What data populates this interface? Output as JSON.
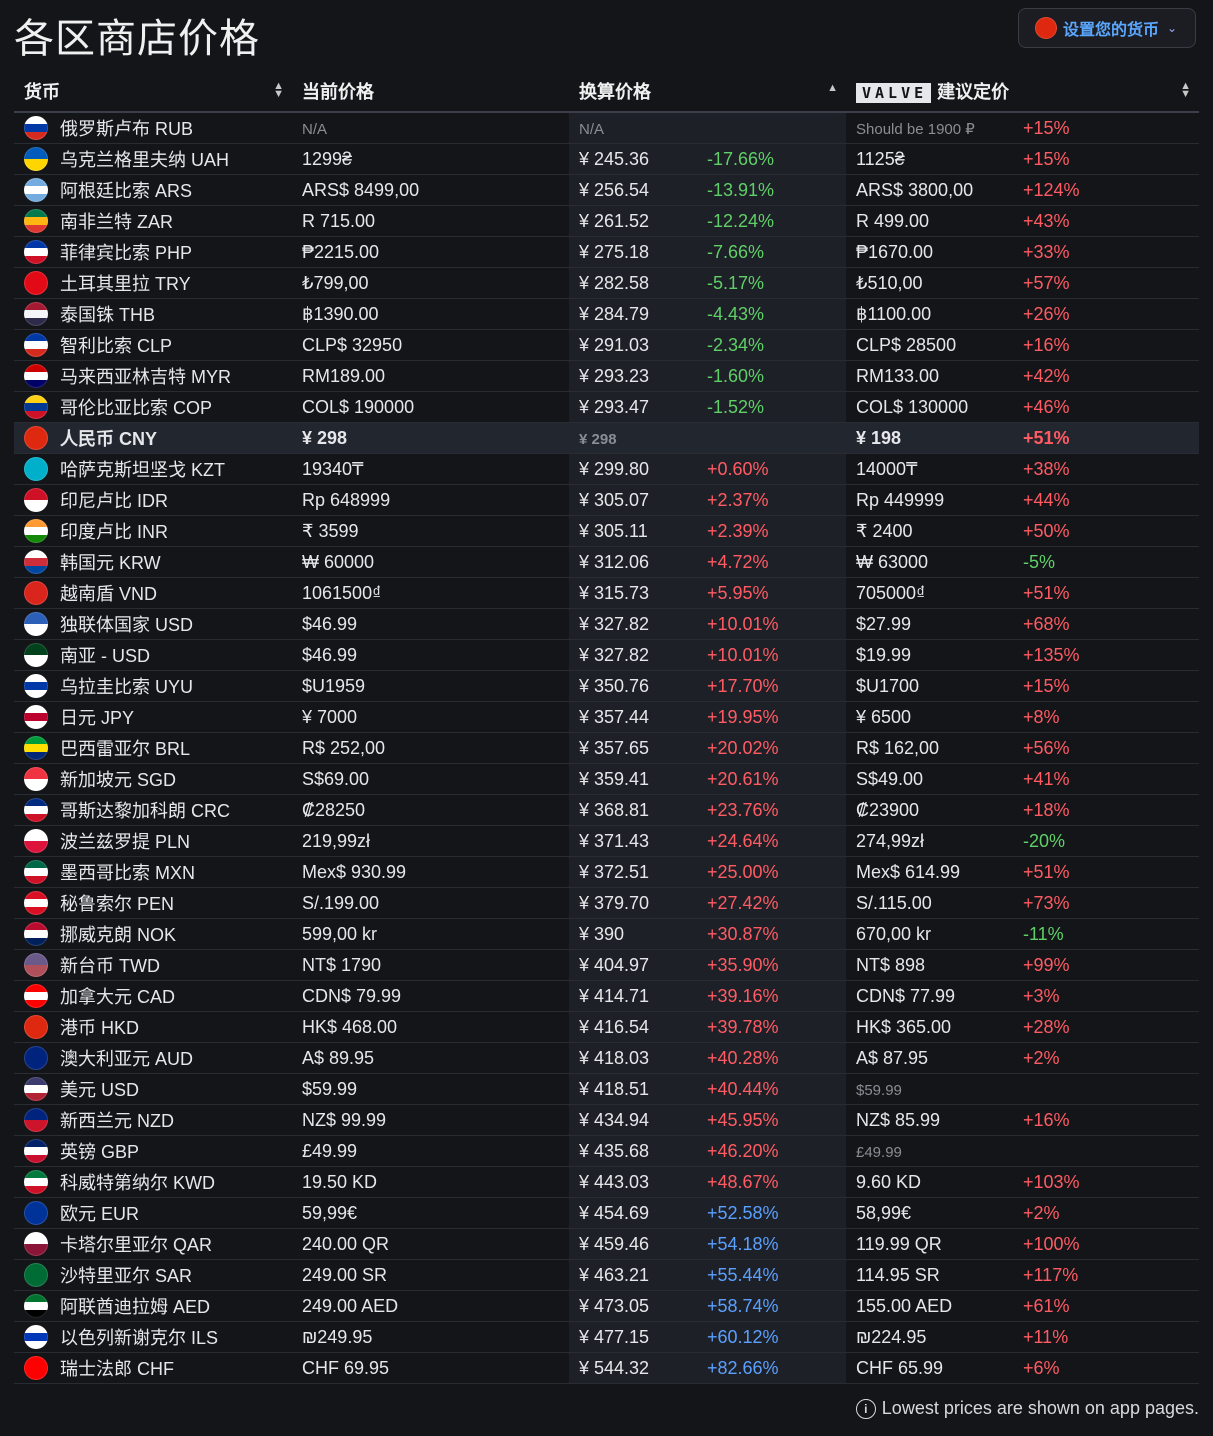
{
  "page": {
    "title": "各区商店价格",
    "currency_button": "设置您的货币",
    "footer": "Lowest prices are shown on app pages."
  },
  "table": {
    "headers": {
      "currency": "货币",
      "current": "当前价格",
      "converted": "换算价格",
      "valve_badge": "VALVE",
      "recommended": "建议定价"
    },
    "rows": [
      {
        "flag": [
          "#ffffff",
          "#0039a6",
          "#d52b1e"
        ],
        "name": "俄罗斯卢布 RUB",
        "current": "N/A",
        "converted": "N/A",
        "diff": "",
        "rec": "Should be 1900 ₽",
        "rec_diff": "+15%",
        "rec_na": true
      },
      {
        "flag": [
          "#005bbb",
          "#ffd500"
        ],
        "name": "乌克兰格里夫纳 UAH",
        "current": "1299₴",
        "converted": "¥ 245.36",
        "diff": "-17.66%",
        "rec": "1125₴",
        "rec_diff": "+15%"
      },
      {
        "flag": [
          "#74acdf",
          "#ffffff",
          "#74acdf"
        ],
        "name": "阿根廷比索 ARS",
        "current": "ARS$ 8499,00",
        "converted": "¥ 256.54",
        "diff": "-13.91%",
        "rec": "ARS$ 3800,00",
        "rec_diff": "+124%"
      },
      {
        "flag": [
          "#007a4d",
          "#ffb612",
          "#de3831"
        ],
        "name": "南非兰特 ZAR",
        "current": "R 715.00",
        "converted": "¥ 261.52",
        "diff": "-12.24%",
        "rec": "R 499.00",
        "rec_diff": "+43%"
      },
      {
        "flag": [
          "#0038a8",
          "#ffffff",
          "#ce1126"
        ],
        "name": "菲律宾比索 PHP",
        "current": "₱2215.00",
        "converted": "¥ 275.18",
        "diff": "-7.66%",
        "rec": "₱1670.00",
        "rec_diff": "+33%"
      },
      {
        "flag": [
          "#e30a17",
          "#e30a17"
        ],
        "name": "土耳其里拉 TRY",
        "current": "₺799,00",
        "converted": "¥ 282.58",
        "diff": "-5.17%",
        "rec": "₺510,00",
        "rec_diff": "+57%"
      },
      {
        "flag": [
          "#a51931",
          "#f4f5f8",
          "#2d2a4a"
        ],
        "name": "泰国铢 THB",
        "current": "฿1390.00",
        "converted": "¥ 284.79",
        "diff": "-4.43%",
        "rec": "฿1100.00",
        "rec_diff": "+26%"
      },
      {
        "flag": [
          "#0039a6",
          "#ffffff",
          "#d52b1e"
        ],
        "name": "智利比索 CLP",
        "current": "CLP$ 32950",
        "converted": "¥ 291.03",
        "diff": "-2.34%",
        "rec": "CLP$ 28500",
        "rec_diff": "+16%"
      },
      {
        "flag": [
          "#cc0001",
          "#ffffff",
          "#010066"
        ],
        "name": "马来西亚林吉特 MYR",
        "current": "RM189.00",
        "converted": "¥ 293.23",
        "diff": "-1.60%",
        "rec": "RM133.00",
        "rec_diff": "+42%"
      },
      {
        "flag": [
          "#fcd116",
          "#003893",
          "#ce1126"
        ],
        "name": "哥伦比亚比索 COP",
        "current": "COL$ 190000",
        "converted": "¥ 293.47",
        "diff": "-1.52%",
        "rec": "COL$ 130000",
        "rec_diff": "+46%"
      },
      {
        "flag": [
          "#de2910",
          "#de2910"
        ],
        "name": "人民币 CNY",
        "current": "¥ 298",
        "converted": "¥ 298",
        "diff": "",
        "rec": "¥ 198",
        "rec_diff": "+51%",
        "highlight": true
      },
      {
        "flag": [
          "#00afca",
          "#00afca"
        ],
        "name": "哈萨克斯坦坚戈 KZT",
        "current": "19340₸",
        "converted": "¥ 299.80",
        "diff": "+0.60%",
        "rec": "14000₸",
        "rec_diff": "+38%"
      },
      {
        "flag": [
          "#ce1126",
          "#ffffff"
        ],
        "name": "印尼卢比 IDR",
        "current": "Rp 648999",
        "converted": "¥ 305.07",
        "diff": "+2.37%",
        "rec": "Rp 449999",
        "rec_diff": "+44%"
      },
      {
        "flag": [
          "#ff9933",
          "#ffffff",
          "#138808"
        ],
        "name": "印度卢比 INR",
        "current": "₹ 3599",
        "converted": "¥ 305.11",
        "diff": "+2.39%",
        "rec": "₹ 2400",
        "rec_diff": "+50%"
      },
      {
        "flag": [
          "#ffffff",
          "#cd2e3a",
          "#0047a0"
        ],
        "name": "韩国元 KRW",
        "current": "₩ 60000",
        "converted": "¥ 312.06",
        "diff": "+4.72%",
        "rec": "₩ 63000",
        "rec_diff": "-5%"
      },
      {
        "flag": [
          "#da251d",
          "#da251d"
        ],
        "name": "越南盾 VND",
        "current": "1061500₫",
        "converted": "¥ 315.73",
        "diff": "+5.95%",
        "rec": "705000₫",
        "rec_diff": "+51%"
      },
      {
        "flag": [
          "#2b5fb8",
          "#ffffff"
        ],
        "name": "独联体国家 USD",
        "current": "$46.99",
        "converted": "¥ 327.82",
        "diff": "+10.01%",
        "rec": "$27.99",
        "rec_diff": "+68%"
      },
      {
        "flag": [
          "#01411c",
          "#ffffff"
        ],
        "name": "南亚 - USD",
        "current": "$46.99",
        "converted": "¥ 327.82",
        "diff": "+10.01%",
        "rec": "$19.99",
        "rec_diff": "+135%"
      },
      {
        "flag": [
          "#ffffff",
          "#0038a8",
          "#ffffff"
        ],
        "name": "乌拉圭比索 UYU",
        "current": "$U1959",
        "converted": "¥ 350.76",
        "diff": "+17.70%",
        "rec": "$U1700",
        "rec_diff": "+15%"
      },
      {
        "flag": [
          "#ffffff",
          "#bc002d",
          "#ffffff"
        ],
        "name": "日元 JPY",
        "current": "¥ 7000",
        "converted": "¥ 357.44",
        "diff": "+19.95%",
        "rec": "¥ 6500",
        "rec_diff": "+8%"
      },
      {
        "flag": [
          "#009c3b",
          "#ffdf00",
          "#002776"
        ],
        "name": "巴西雷亚尔 BRL",
        "current": "R$ 252,00",
        "converted": "¥ 357.65",
        "diff": "+20.02%",
        "rec": "R$ 162,00",
        "rec_diff": "+56%"
      },
      {
        "flag": [
          "#ef3340",
          "#ffffff"
        ],
        "name": "新加坡元 SGD",
        "current": "S$69.00",
        "converted": "¥ 359.41",
        "diff": "+20.61%",
        "rec": "S$49.00",
        "rec_diff": "+41%"
      },
      {
        "flag": [
          "#002b7f",
          "#ffffff",
          "#ce1126"
        ],
        "name": "哥斯达黎加科朗 CRC",
        "current": "₡28250",
        "converted": "¥ 368.81",
        "diff": "+23.76%",
        "rec": "₡23900",
        "rec_diff": "+18%"
      },
      {
        "flag": [
          "#ffffff",
          "#dc143c"
        ],
        "name": "波兰兹罗提 PLN",
        "current": "219,99zł",
        "converted": "¥ 371.43",
        "diff": "+24.64%",
        "rec": "274,99zł",
        "rec_diff": "-20%"
      },
      {
        "flag": [
          "#006847",
          "#ffffff",
          "#ce1126"
        ],
        "name": "墨西哥比索 MXN",
        "current": "Mex$ 930.99",
        "converted": "¥ 372.51",
        "diff": "+25.00%",
        "rec": "Mex$ 614.99",
        "rec_diff": "+51%"
      },
      {
        "flag": [
          "#d91023",
          "#ffffff",
          "#d91023"
        ],
        "name": "秘鲁索尔 PEN",
        "current": "S/.199.00",
        "converted": "¥ 379.70",
        "diff": "+27.42%",
        "rec": "S/.115.00",
        "rec_diff": "+73%"
      },
      {
        "flag": [
          "#ba0c2f",
          "#ffffff",
          "#00205b"
        ],
        "name": "挪威克朗 NOK",
        "current": "599,00 kr",
        "converted": "¥ 390",
        "diff": "+30.87%",
        "rec": "670,00 kr",
        "rec_diff": "-11%"
      },
      {
        "flag": [
          "#6a5a8a",
          "#b0505a"
        ],
        "name": "新台币 TWD",
        "current": "NT$ 1790",
        "converted": "¥ 404.97",
        "diff": "+35.90%",
        "rec": "NT$ 898",
        "rec_diff": "+99%"
      },
      {
        "flag": [
          "#ff0000",
          "#ffffff",
          "#ff0000"
        ],
        "name": "加拿大元 CAD",
        "current": "CDN$ 79.99",
        "converted": "¥ 414.71",
        "diff": "+39.16%",
        "rec": "CDN$ 77.99",
        "rec_diff": "+3%"
      },
      {
        "flag": [
          "#de2910",
          "#de2910"
        ],
        "name": "港币 HKD",
        "current": "HK$ 468.00",
        "converted": "¥ 416.54",
        "diff": "+39.78%",
        "rec": "HK$ 365.00",
        "rec_diff": "+28%"
      },
      {
        "flag": [
          "#00247d",
          "#00247d"
        ],
        "name": "澳大利亚元 AUD",
        "current": "A$ 89.95",
        "converted": "¥ 418.03",
        "diff": "+40.28%",
        "rec": "A$ 87.95",
        "rec_diff": "+2%"
      },
      {
        "flag": [
          "#3c3b6e",
          "#ffffff",
          "#b22234"
        ],
        "name": "美元 USD",
        "current": "$59.99",
        "converted": "¥ 418.51",
        "diff": "+40.44%",
        "rec": "$59.99",
        "rec_diff": "",
        "rec_na": true
      },
      {
        "flag": [
          "#00247d",
          "#cc142b"
        ],
        "name": "新西兰元 NZD",
        "current": "NZ$ 99.99",
        "converted": "¥ 434.94",
        "diff": "+45.95%",
        "rec": "NZ$ 85.99",
        "rec_diff": "+16%"
      },
      {
        "flag": [
          "#012169",
          "#ffffff",
          "#c8102e"
        ],
        "name": "英镑 GBP",
        "current": "£49.99",
        "converted": "¥ 435.68",
        "diff": "+46.20%",
        "rec": "£49.99",
        "rec_diff": "",
        "rec_na": true
      },
      {
        "flag": [
          "#007a3d",
          "#ffffff",
          "#ce1126"
        ],
        "name": "科威特第纳尔 KWD",
        "current": "19.50 KD",
        "converted": "¥ 443.03",
        "diff": "+48.67%",
        "rec": "9.60 KD",
        "rec_diff": "+103%"
      },
      {
        "flag": [
          "#003399",
          "#003399"
        ],
        "name": "欧元 EUR",
        "current": "59,99€",
        "converted": "¥ 454.69",
        "diff": "+52.58%",
        "rec": "58,99€",
        "rec_diff": "+2%",
        "blue": true
      },
      {
        "flag": [
          "#ffffff",
          "#8a1538"
        ],
        "name": "卡塔尔里亚尔 QAR",
        "current": "240.00 QR",
        "converted": "¥ 459.46",
        "diff": "+54.18%",
        "rec": "119.99 QR",
        "rec_diff": "+100%",
        "blue": true
      },
      {
        "flag": [
          "#006c35",
          "#006c35"
        ],
        "name": "沙特里亚尔 SAR",
        "current": "249.00 SR",
        "converted": "¥ 463.21",
        "diff": "+55.44%",
        "rec": "114.95 SR",
        "rec_diff": "+117%",
        "blue": true
      },
      {
        "flag": [
          "#00732f",
          "#ffffff",
          "#000000"
        ],
        "name": "阿联酋迪拉姆 AED",
        "current": "249.00 AED",
        "converted": "¥ 473.05",
        "diff": "+58.74%",
        "rec": "155.00 AED",
        "rec_diff": "+61%",
        "blue": true
      },
      {
        "flag": [
          "#ffffff",
          "#0038b8",
          "#ffffff"
        ],
        "name": "以色列新谢克尔 ILS",
        "current": "₪249.95",
        "converted": "¥ 477.15",
        "diff": "+60.12%",
        "rec": "₪224.95",
        "rec_diff": "+11%",
        "blue": true
      },
      {
        "flag": [
          "#ff0000",
          "#ff0000"
        ],
        "name": "瑞士法郎 CHF",
        "current": "CHF 69.95",
        "converted": "¥ 544.32",
        "diff": "+82.66%",
        "rec": "CHF 65.99",
        "rec_diff": "+6%",
        "blue": true
      }
    ]
  },
  "colors": {
    "positive": "#ff5b63",
    "negative": "#5fd068",
    "blue": "#5aa0ff",
    "accent": "#5aa7ff"
  }
}
